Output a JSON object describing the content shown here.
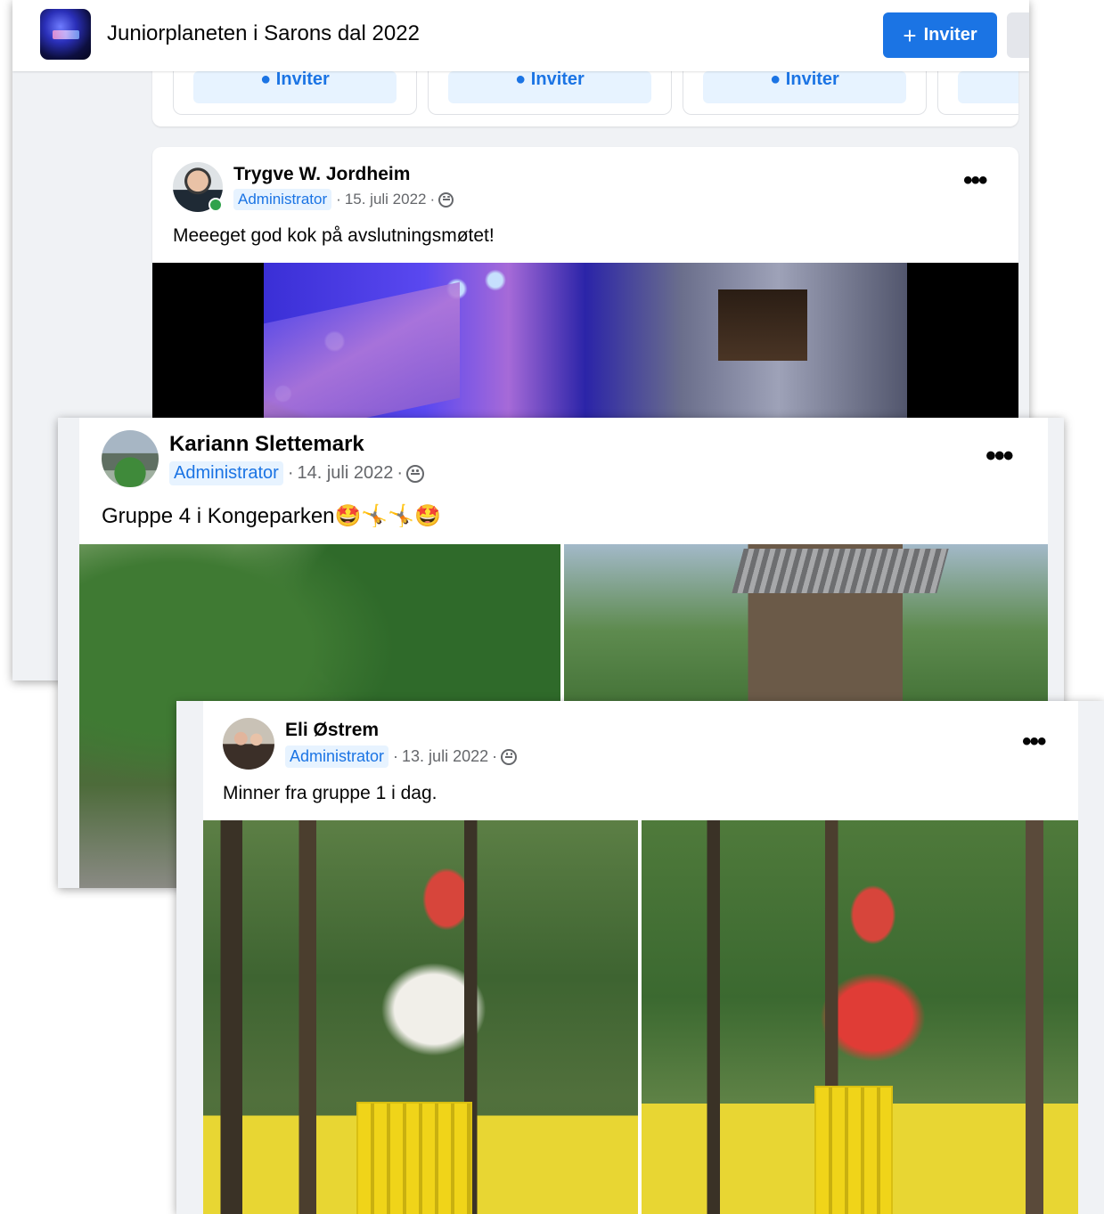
{
  "group": {
    "title": "Juniorplaneten i Sarons dal 2022",
    "invite_button": "Inviter",
    "invite_card_label": "Inviter"
  },
  "posts": [
    {
      "author": "Trygve W. Jordheim",
      "role": "Administrator",
      "date": "15. juli 2022",
      "text": "Meeeget god kok på avslutningsmøtet!"
    },
    {
      "author": "Kariann Slettemark",
      "role": "Administrator",
      "date": "14. juli 2022",
      "text": "Gruppe 4 i Kongeparken🤩🤸🤸🤩"
    },
    {
      "author": "Eli Østrem",
      "role": "Administrator",
      "date": "13. juli 2022",
      "text": "Minner fra gruppe 1 i dag."
    }
  ],
  "colors": {
    "accent": "#1b74e4",
    "badge_bg": "#e7f3ff",
    "secondary_text": "#65676b",
    "online": "#31a24c"
  },
  "icons": {
    "audience": "globe-icon",
    "more": "more-options-icon",
    "invite": "person-icon"
  }
}
